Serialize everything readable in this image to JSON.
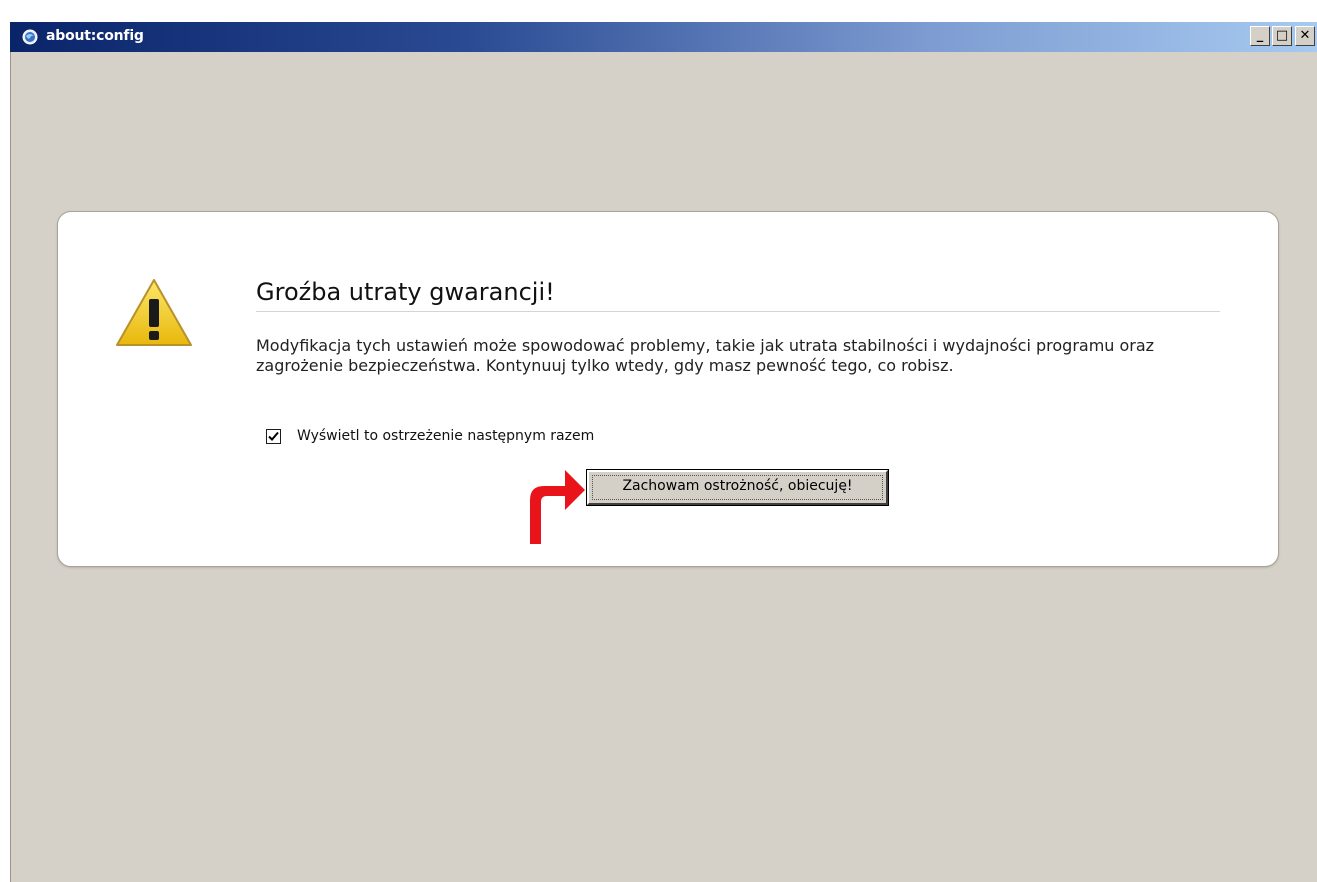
{
  "window": {
    "title": "about:config",
    "controls": {
      "minimize": "_",
      "maximize": "□",
      "close": "✕"
    },
    "icon": "browser-globe-icon"
  },
  "warning": {
    "icon": "warning-triangle-icon",
    "heading": "Groźba utraty gwarancji!",
    "message": "Modyfikacja tych ustawień może spowodować problemy, takie jak utrata stabilności i wydajności programu oraz zagrożenie bezpieczeństwa. Kontynuuj tylko wtedy, gdy masz pewność tego, co robisz.",
    "checkbox": {
      "label": "Wyświetl to ostrzeżenie następnym razem",
      "checked": true
    },
    "confirm_button": "Zachowam ostrożność, obiecuję!"
  },
  "annotation": {
    "icon": "red-arrow-icon",
    "color": "#e8141a"
  },
  "colors": {
    "background": "#d6d1c8",
    "titlebar_start": "#0a246a",
    "titlebar_end": "#a6caf0",
    "warning_yellow": "#f3d11c"
  }
}
